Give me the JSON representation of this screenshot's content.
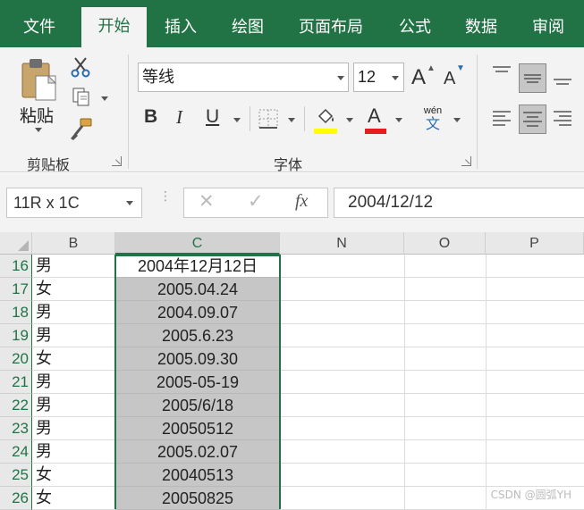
{
  "tabs": [
    {
      "label": "文件"
    },
    {
      "label": "开始"
    },
    {
      "label": "插入"
    },
    {
      "label": "绘图"
    },
    {
      "label": "页面布局"
    },
    {
      "label": "公式"
    },
    {
      "label": "数据"
    },
    {
      "label": "审阅"
    }
  ],
  "active_tab": "开始",
  "ribbon": {
    "clipboard": {
      "paste_label": "粘贴",
      "group_label": "剪贴板"
    },
    "font": {
      "font_name": "等线",
      "font_size": "12",
      "grow_icon": "A",
      "shrink_icon": "A",
      "bold": "B",
      "italic": "I",
      "underline": "U",
      "font_color_glyph": "A",
      "phonetic_top": "wén",
      "phonetic_bottom": "文",
      "group_label": "字体",
      "highlight_color": "#ffff00",
      "font_color": "#e51c23"
    }
  },
  "formula_bar": {
    "name_box": "11R x 1C",
    "cancel_glyph": "✕",
    "enter_glyph": "✓",
    "fx_glyph": "fx",
    "value": "2004/12/12"
  },
  "columns": [
    "B",
    "C",
    "N",
    "O",
    "P"
  ],
  "rows": [
    {
      "num": "16",
      "b": "男",
      "c": "2004年12月12日"
    },
    {
      "num": "17",
      "b": "女",
      "c": "2005.04.24"
    },
    {
      "num": "18",
      "b": "男",
      "c": "2004.09.07"
    },
    {
      "num": "19",
      "b": "男",
      "c": "2005.6.23"
    },
    {
      "num": "20",
      "b": "女",
      "c": "2005.09.30"
    },
    {
      "num": "21",
      "b": "男",
      "c": "2005-05-19"
    },
    {
      "num": "22",
      "b": "男",
      "c": "2005/6/18"
    },
    {
      "num": "23",
      "b": "男",
      "c": "20050512"
    },
    {
      "num": "24",
      "b": "男",
      "c": "2005.02.07"
    },
    {
      "num": "25",
      "b": "女",
      "c": "20040513"
    },
    {
      "num": "26",
      "b": "女",
      "c": "20050825"
    }
  ],
  "watermark": "CSDN @圆弧YH",
  "colors": {
    "accent": "#217346",
    "selection_fill": "#c6c6c6"
  }
}
